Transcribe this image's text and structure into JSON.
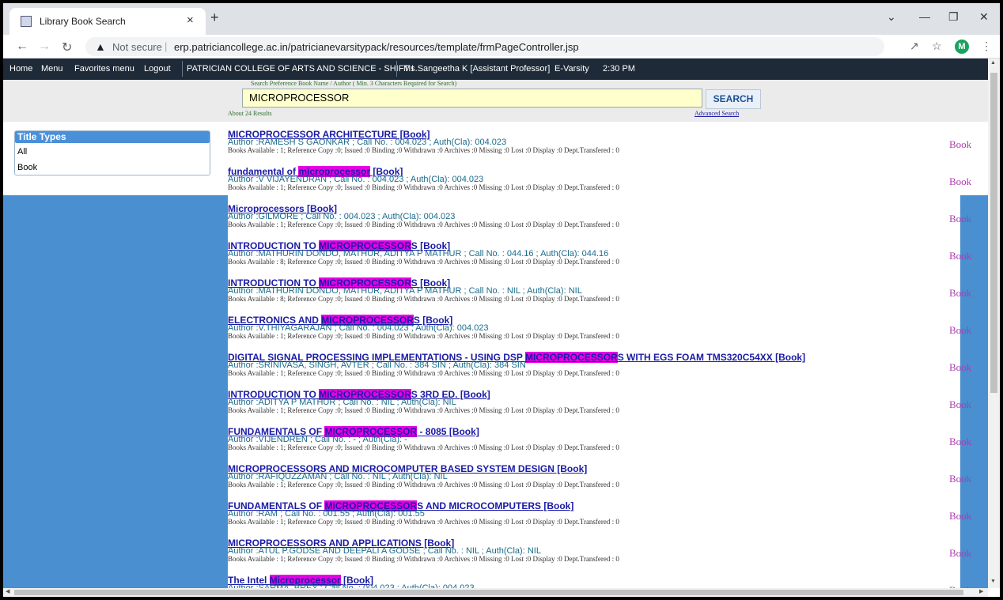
{
  "browser": {
    "tab_title": "Library Book Search",
    "tab_close": "×",
    "new_tab": "+",
    "not_secure": "Not secure",
    "url": "erp.patriciancollege.ac.in/patricianevarsitypack/resources/template/frmPageController.jsp",
    "profile_initial": "M"
  },
  "menubar": {
    "home": "Home",
    "menu": "Menu",
    "favorites": "Favorites menu",
    "logout": "Logout",
    "college": "PATRICIAN COLLEGE OF ARTS AND SCIENCE - SHIFT I",
    "user": "Ms.Sangeetha K [Assistant Professor]",
    "evarsity": "E-Varsity",
    "time": "2:30 PM"
  },
  "search": {
    "hint": "Search Preference Book Name / Author ( Min. 3 Characters Required for Search)",
    "value": "MICROPROCESSOR",
    "button": "SEARCH",
    "about": "About 24 Results",
    "advanced": "Advanced Search"
  },
  "title_types": {
    "heading": "Title Types",
    "items": [
      "All",
      "Book"
    ]
  },
  "results": [
    {
      "pre": "MICROPROCESSOR ARCHITECTURE [Book]",
      "hl": "",
      "post": "",
      "author": "Author :RAMESH S GAONKAR ;   Call No. : 004.023 ;   Auth(Cla): 004.023",
      "avail": "Books Available : 1; Reference Copy :0; Issued :0 Binding :0 Withdrawn :0 Archives :0 Missing :0 Lost :0 Display :0 Dept.Transfered : 0",
      "type": "Book"
    },
    {
      "pre": "fundamental of ",
      "hl": "microprocessor",
      "post": " [Book]",
      "author": "Author :V VIJAYENDRAN ;   Call No. : 004.023 ;   Auth(Cla): 004.023",
      "avail": "Books Available : 1; Reference Copy :0; Issued :0 Binding :0 Withdrawn :0 Archives :0 Missing :0 Lost :0 Display :0 Dept.Transfered : 0",
      "type": "Book"
    },
    {
      "pre": "Microprocessors [Book]",
      "hl": "",
      "post": "",
      "author": "Author :GILMORE ;   Call No. : 004.023 ;   Auth(Cla): 004.023",
      "avail": "Books Available : 1; Reference Copy :0; Issued :0 Binding :0 Withdrawn :0 Archives :0 Missing :0 Lost :0 Display :0 Dept.Transfered : 0",
      "type": "Book"
    },
    {
      "pre": "INTRODUCTION TO ",
      "hl": "MICROPROCESSOR",
      "post": "S [Book]",
      "author": "Author :MATHURIN DONDO, MATHUR, ADITYA P MATHUR ;   Call No. : 044.16 ;   Auth(Cla): 044.16",
      "avail": "Books Available : 8; Reference Copy :0; Issued :0 Binding :0 Withdrawn :0 Archives :0 Missing :0 Lost :0 Display :0 Dept.Transfered : 0",
      "type": "Book"
    },
    {
      "pre": "INTRODUCTION TO ",
      "hl": "MICROPROCESSOR",
      "post": "S [Book]",
      "author": "Author :MATHURIN DONDO, MATHUR, ADITYA P MATHUR ;   Call No. : NIL ;   Auth(Cla): NIL",
      "avail": "Books Available : 8; Reference Copy :0; Issued :0 Binding :0 Withdrawn :0 Archives :0 Missing :0 Lost :0 Display :0 Dept.Transfered : 0",
      "type": "Book"
    },
    {
      "pre": "ELECTRONICS AND ",
      "hl": "MICROPROCESSOR",
      "post": "S [Book]",
      "author": "Author :V.THIYAGARAJAN ;   Call No. : 004.023 ;   Auth(Cla): 004.023",
      "avail": "Books Available : 1; Reference Copy :0; Issued :0 Binding :0 Withdrawn :0 Archives :0 Missing :0 Lost :0 Display :0 Dept.Transfered : 0",
      "type": "Book"
    },
    {
      "pre": "DIGITAL SIGNAL PROCESSING IMPLEMENTATIONS - USING DSP ",
      "hl": "MICROPROCESSOR",
      "post": "S WITH EGS FOAM TMS320C54XX [Book]",
      "author": "Author :SRINIVASA, SINGH, AVTER ;   Call No. : 384 SIN ;   Auth(Cla): 384 SIN",
      "avail": "Books Available : 1; Reference Copy :0; Issued :0 Binding :0 Withdrawn :0 Archives :0 Missing :0 Lost :0 Display :0 Dept.Transfered : 0",
      "type": "Book"
    },
    {
      "pre": "INTRODUCTION TO ",
      "hl": "MICROPROCESSOR",
      "post": "S 3RD ED. [Book]",
      "author": "Author :ADITYA P MATHUR ;   Call No. : NIL ;   Auth(Cla): NIL",
      "avail": "Books Available : 1; Reference Copy :0; Issued :0 Binding :0 Withdrawn :0 Archives :0 Missing :0 Lost :0 Display :0 Dept.Transfered : 0",
      "type": "Book"
    },
    {
      "pre": "FUNDAMENTALS OF ",
      "hl": "MICROPROCESSOR",
      "post": " - 8085 [Book]",
      "author": "Author :VIJENDREN ;   Call No. : - ;   Auth(Cla): -",
      "avail": "Books Available : 1; Reference Copy :0; Issued :0 Binding :0 Withdrawn :0 Archives :0 Missing :0 Lost :0 Display :0 Dept.Transfered : 0",
      "type": "Book"
    },
    {
      "pre": "MICROPROCESSORS AND MICROCOMPUTER BASED SYSTEM DESIGN [Book]",
      "hl": "",
      "post": "",
      "author": "Author :RAFIQUZZAMAN ;   Call No. : NIL ;   Auth(Cla): NIL",
      "avail": "Books Available : 1; Reference Copy :0; Issued :0 Binding :0 Withdrawn :0 Archives :0 Missing :0 Lost :0 Display :0 Dept.Transfered : 0",
      "type": "Book"
    },
    {
      "pre": "FUNDAMENTALS OF ",
      "hl": "MICROPROCESSOR",
      "post": "S AND MICROCOMPUTERS [Book]",
      "author": "Author :RAM ;   Call No. : 001.55 ;   Auth(Cla): 001.55",
      "avail": "Books Available : 1; Reference Copy :0; Issued :0 Binding :0 Withdrawn :0 Archives :0 Missing :0 Lost :0 Display :0 Dept.Transfered : 0",
      "type": "Book"
    },
    {
      "pre": "MICROPROCESSORS AND APPLICATIONS [Book]",
      "hl": "",
      "post": "",
      "author": "Author :ATUL P.GODSE AND DEEPALI A GODSE ;   Call No. : NIL ;   Auth(Cla): NIL",
      "avail": "Books Available : 1; Reference Copy :0; Issued :0 Binding :0 Withdrawn :0 Archives :0 Missing :0 Lost :0 Display :0 Dept.Transfered : 0",
      "type": "Book"
    },
    {
      "pre": "The Intel ",
      "hl": "Microprocessor",
      "post": " [Book]",
      "author": "Author :SARMA, BREY ;   Call No. : 004.023 ;   Auth(Cla): 004.023",
      "avail": "",
      "type": "Book"
    }
  ],
  "icons": {
    "back": "arrow-left-icon",
    "forward": "arrow-right-icon",
    "reload": "reload-icon",
    "warning": "warning-icon",
    "share": "share-icon",
    "star": "star-icon",
    "more": "kebab-menu-icon"
  },
  "colors": {
    "menubar": "#1e2a38",
    "panel": "#4a8fcf",
    "highlight": "#e600e6",
    "link": "#1a1aa6"
  }
}
